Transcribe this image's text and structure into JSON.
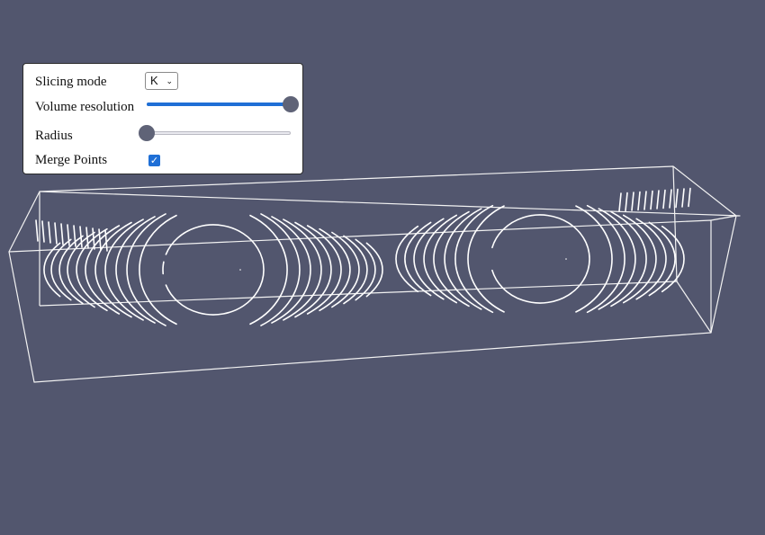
{
  "controls": {
    "slicing_mode_label": "Slicing mode",
    "slicing_mode_value": "K",
    "volume_resolution_label": "Volume resolution",
    "volume_resolution_value": 1.0,
    "radius_label": "Radius",
    "radius_value": 0.0,
    "merge_points_label": "Merge Points",
    "merge_points_checked": true
  },
  "colors": {
    "background": "#52566e",
    "slider_fill": "#1f6fd6",
    "slider_thumb": "#5f6377",
    "line": "#ffffff"
  },
  "icons": {
    "select_chevron": "chevron-down-icon",
    "checkbox": "checkmark-icon"
  }
}
